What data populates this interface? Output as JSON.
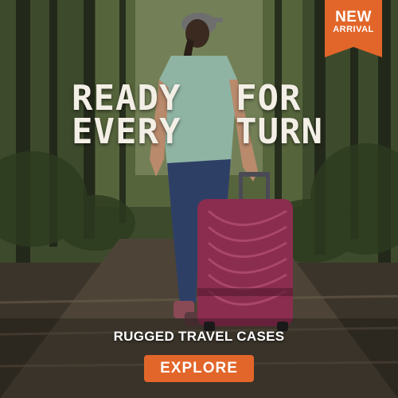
{
  "badge": {
    "line1": "NEW",
    "line2": "ARRIVAL"
  },
  "headline": {
    "left_lines": [
      "READY",
      "EVERY"
    ],
    "right_lines": [
      "FOR",
      "TURN"
    ]
  },
  "tagline": "RUGGED TRAVEL CASES",
  "cta": {
    "label": "EXPLORE"
  },
  "colors": {
    "accent": "#e2662a",
    "suitcase": "#8a2d4f",
    "shirt": "#8fb4a4",
    "jeans": "#2e3f66"
  }
}
